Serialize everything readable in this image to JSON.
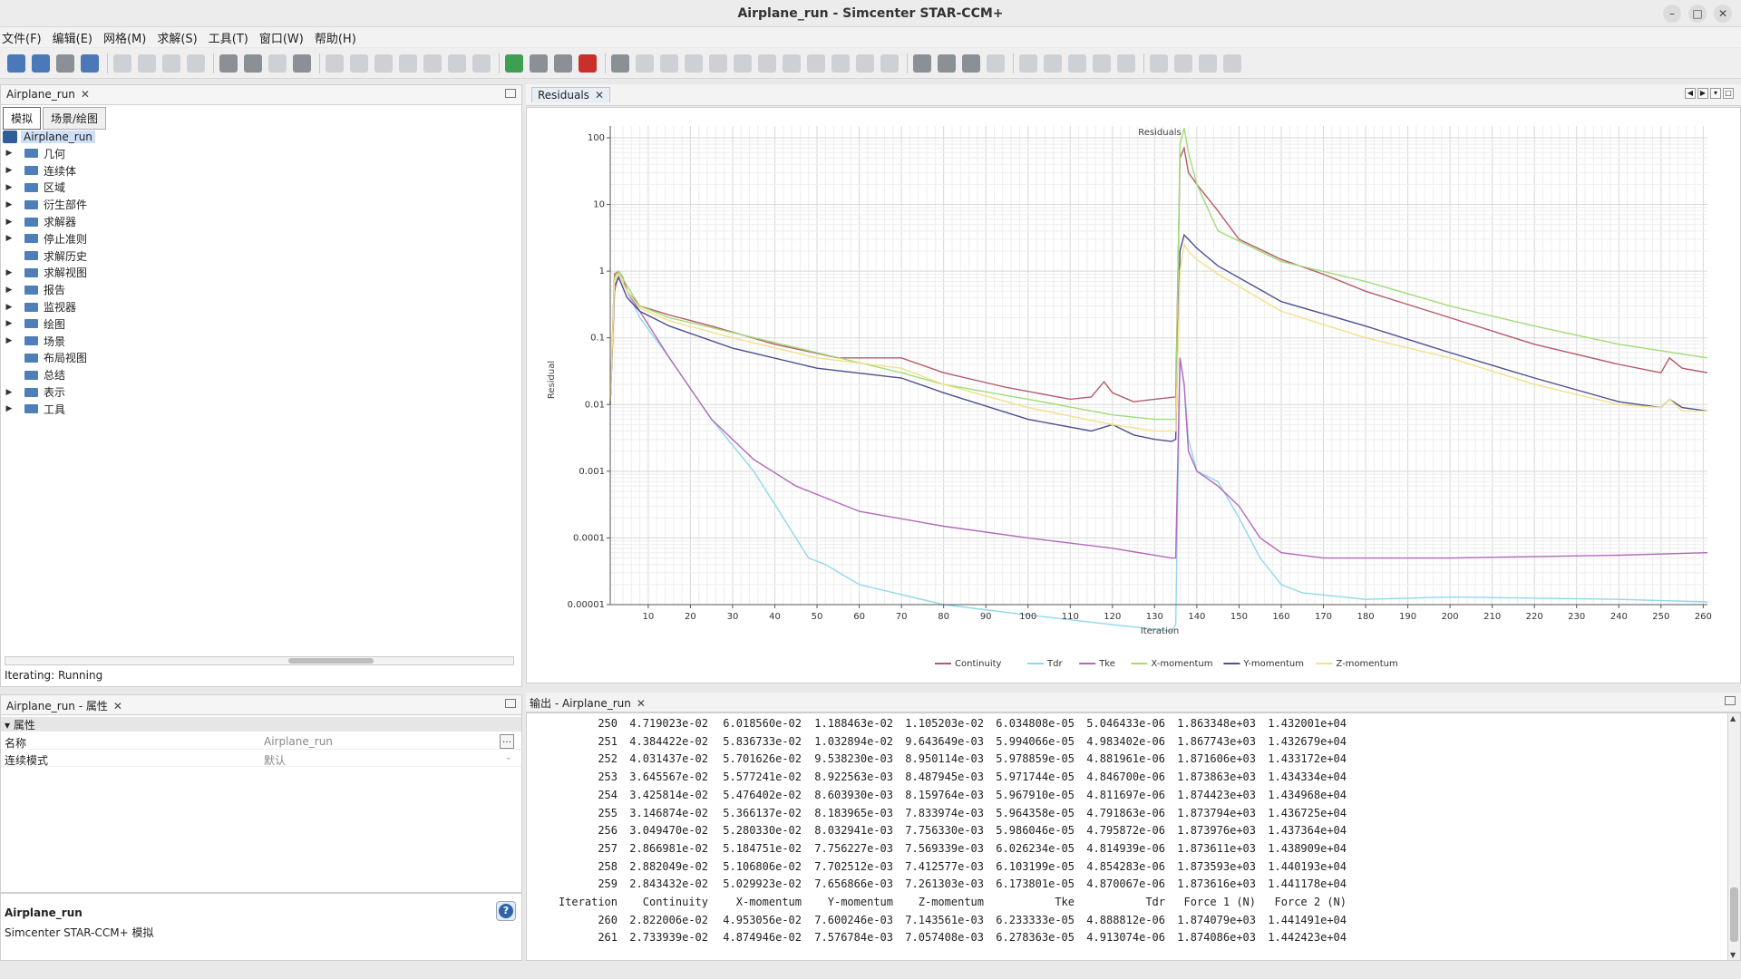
{
  "window": {
    "title": "Airplane_run - Simcenter STAR-CCM+"
  },
  "menu": [
    "文件(F)",
    "编辑(E)",
    "网格(M)",
    "求解(S)",
    "工具(T)",
    "窗口(W)",
    "帮助(H)"
  ],
  "tree_panel": {
    "tab_label": "Airplane_run",
    "subtabs": [
      "模拟",
      "场景/绘图"
    ],
    "root_label": "Airplane_run",
    "items": [
      {
        "label": "几何",
        "expandable": true
      },
      {
        "label": "连续体",
        "expandable": true
      },
      {
        "label": "区域",
        "expandable": true
      },
      {
        "label": "衍生部件",
        "expandable": true
      },
      {
        "label": "求解器",
        "expandable": true
      },
      {
        "label": "停止准则",
        "expandable": true
      },
      {
        "label": "求解历史",
        "expandable": false
      },
      {
        "label": "求解视图",
        "expandable": true
      },
      {
        "label": "报告",
        "expandable": true
      },
      {
        "label": "监视器",
        "expandable": true
      },
      {
        "label": "绘图",
        "expandable": true
      },
      {
        "label": "场景",
        "expandable": true
      },
      {
        "label": "布局视图",
        "expandable": false
      },
      {
        "label": "总结",
        "expandable": false
      },
      {
        "label": "表示",
        "expandable": true
      },
      {
        "label": "工具",
        "expandable": true
      }
    ],
    "status": "Iterating: Running"
  },
  "properties_panel": {
    "tab_label": "Airplane_run - 属性",
    "header": "属性",
    "rows": [
      {
        "key": "名称",
        "value": "Airplane_run",
        "has_button": true
      },
      {
        "key": "连续模式",
        "value": "默认",
        "has_button": false
      }
    ]
  },
  "description": {
    "name": "Airplane_run",
    "text": "Simcenter STAR-CCM+ 模拟"
  },
  "plot_tab": {
    "label": "Residuals"
  },
  "chart_data": {
    "type": "line",
    "title": "Residuals",
    "xlabel": "Iteration",
    "ylabel": "Residual",
    "yscale": "log",
    "xlim": [
      1,
      261
    ],
    "ylim": [
      1e-05,
      150
    ],
    "xticks": [
      10,
      20,
      30,
      40,
      50,
      60,
      70,
      80,
      90,
      100,
      110,
      120,
      130,
      140,
      150,
      160,
      170,
      180,
      190,
      200,
      210,
      220,
      230,
      240,
      250,
      260
    ],
    "yticks": [
      {
        "value": 100,
        "label": "100"
      },
      {
        "value": 10,
        "label": "10"
      },
      {
        "value": 1,
        "label": "1"
      },
      {
        "value": 0.1,
        "label": "0.1"
      },
      {
        "value": 0.01,
        "label": "0.01"
      },
      {
        "value": 0.001,
        "label": "0.001"
      },
      {
        "value": 0.0001,
        "label": "0.0001"
      },
      {
        "value": 1e-05,
        "label": "0.00001"
      }
    ],
    "grid": true,
    "legend_position": "bottom",
    "series": [
      {
        "name": "Continuity",
        "color": "#b65a6a",
        "x": [
          1,
          2,
          3,
          4,
          5,
          8,
          15,
          25,
          40,
          55,
          65,
          70,
          80,
          95,
          110,
          115,
          118,
          120,
          125,
          130,
          135,
          136,
          137,
          138,
          140,
          145,
          150,
          160,
          170,
          180,
          200,
          220,
          240,
          250,
          252,
          255,
          261
        ],
        "y": [
          0.01,
          0.9,
          1.0,
          0.8,
          0.5,
          0.3,
          0.22,
          0.15,
          0.08,
          0.05,
          0.05,
          0.05,
          0.03,
          0.018,
          0.012,
          0.013,
          0.022,
          0.015,
          0.011,
          0.012,
          0.013,
          50,
          70,
          30,
          20,
          8,
          3,
          1.5,
          0.9,
          0.5,
          0.2,
          0.08,
          0.04,
          0.03,
          0.05,
          0.035,
          0.03
        ]
      },
      {
        "name": "Tdr",
        "color": "#8fd8ea",
        "x": [
          1,
          2,
          3,
          5,
          8,
          15,
          25,
          35,
          42,
          48,
          52,
          60,
          80,
          100,
          120,
          134,
          135,
          136,
          137,
          138,
          140,
          145,
          150,
          155,
          160,
          165,
          180,
          200,
          240,
          261
        ],
        "y": [
          0.01,
          0.5,
          0.9,
          0.5,
          0.2,
          0.05,
          0.006,
          0.001,
          0.0002,
          5e-05,
          4e-05,
          2e-05,
          1e-05,
          7e-06,
          5e-06,
          4e-06,
          5e-06,
          0.05,
          0.02,
          0.003,
          0.001,
          0.0007,
          0.0002,
          5e-05,
          2e-05,
          1.5e-05,
          1.2e-05,
          1.3e-05,
          1.2e-05,
          1.1e-05
        ]
      },
      {
        "name": "Tke",
        "color": "#b368bc",
        "x": [
          1,
          2,
          3,
          5,
          8,
          15,
          25,
          35,
          45,
          60,
          80,
          100,
          120,
          134,
          135,
          136,
          137,
          138,
          140,
          145,
          150,
          155,
          160,
          170,
          200,
          240,
          261
        ],
        "y": [
          0.01,
          0.5,
          0.9,
          0.5,
          0.25,
          0.05,
          0.006,
          0.0015,
          0.0006,
          0.00025,
          0.00015,
          0.0001,
          7e-05,
          5e-05,
          5e-05,
          0.05,
          0.02,
          0.002,
          0.001,
          0.0006,
          0.0003,
          0.0001,
          6e-05,
          5e-05,
          5e-05,
          5.5e-05,
          6e-05
        ]
      },
      {
        "name": "X-momentum",
        "color": "#a0dc78",
        "x": [
          1,
          2,
          3,
          5,
          8,
          15,
          30,
          50,
          70,
          80,
          100,
          120,
          130,
          134,
          135,
          136,
          137,
          138,
          140,
          145,
          160,
          180,
          200,
          220,
          240,
          261
        ],
        "y": [
          0.01,
          0.8,
          1.0,
          0.6,
          0.3,
          0.2,
          0.12,
          0.06,
          0.03,
          0.02,
          0.012,
          0.007,
          0.006,
          0.006,
          0.006,
          80,
          140,
          60,
          20,
          4,
          1.4,
          0.7,
          0.3,
          0.15,
          0.08,
          0.05
        ]
      },
      {
        "name": "Y-momentum",
        "color": "#4e4f8e",
        "x": [
          1,
          2,
          3,
          5,
          8,
          15,
          30,
          50,
          70,
          80,
          100,
          115,
          120,
          125,
          130,
          134,
          135,
          136,
          137,
          138,
          140,
          145,
          160,
          180,
          200,
          220,
          240,
          250,
          252,
          255,
          261
        ],
        "y": [
          0.01,
          0.6,
          0.8,
          0.4,
          0.25,
          0.15,
          0.07,
          0.035,
          0.025,
          0.015,
          0.006,
          0.004,
          0.005,
          0.0035,
          0.003,
          0.0028,
          0.003,
          2,
          3.5,
          3,
          2.2,
          1.2,
          0.35,
          0.15,
          0.06,
          0.025,
          0.011,
          0.009,
          0.012,
          0.009,
          0.008
        ]
      },
      {
        "name": "Z-momentum",
        "color": "#f2e08a",
        "x": [
          1,
          2,
          3,
          5,
          8,
          15,
          30,
          50,
          70,
          80,
          100,
          120,
          130,
          134,
          135,
          136,
          137,
          138,
          140,
          145,
          160,
          180,
          200,
          220,
          240,
          250,
          252,
          255,
          261
        ],
        "y": [
          0.01,
          0.7,
          0.9,
          0.5,
          0.28,
          0.18,
          0.1,
          0.05,
          0.035,
          0.02,
          0.009,
          0.005,
          0.004,
          0.004,
          0.004,
          1,
          2.5,
          2,
          1.5,
          0.9,
          0.25,
          0.1,
          0.05,
          0.02,
          0.01,
          0.009,
          0.012,
          0.008,
          0.008
        ]
      }
    ]
  },
  "output_panel": {
    "tab_label": "输出 - Airplane_run",
    "header": [
      "Iteration",
      "Continuity",
      "X-momentum",
      "Y-momentum",
      "Z-momentum",
      "Tke",
      "Tdr",
      "Force 1 (N)",
      "Force 2 (N)"
    ],
    "rows_before_header": [
      [
        "250",
        "4.719023e-02",
        "6.018560e-02",
        "1.188463e-02",
        "1.105203e-02",
        "6.034808e-05",
        "5.046433e-06",
        "1.863348e+03",
        "1.432001e+04"
      ],
      [
        "251",
        "4.384422e-02",
        "5.836733e-02",
        "1.032894e-02",
        "9.643649e-03",
        "5.994066e-05",
        "4.983402e-06",
        "1.867743e+03",
        "1.432679e+04"
      ],
      [
        "252",
        "4.031437e-02",
        "5.701626e-02",
        "9.538230e-03",
        "8.950114e-03",
        "5.978859e-05",
        "4.881961e-06",
        "1.871606e+03",
        "1.433172e+04"
      ],
      [
        "253",
        "3.645567e-02",
        "5.577241e-02",
        "8.922563e-03",
        "8.487945e-03",
        "5.971744e-05",
        "4.846700e-06",
        "1.873863e+03",
        "1.434334e+04"
      ],
      [
        "254",
        "3.425814e-02",
        "5.476402e-02",
        "8.603930e-03",
        "8.159764e-03",
        "5.967910e-05",
        "4.811697e-06",
        "1.874423e+03",
        "1.434968e+04"
      ],
      [
        "255",
        "3.146874e-02",
        "5.366137e-02",
        "8.183965e-03",
        "7.833974e-03",
        "5.964358e-05",
        "4.791863e-06",
        "1.873794e+03",
        "1.436725e+04"
      ],
      [
        "256",
        "3.049470e-02",
        "5.280330e-02",
        "8.032941e-03",
        "7.756330e-03",
        "5.986046e-05",
        "4.795872e-06",
        "1.873976e+03",
        "1.437364e+04"
      ],
      [
        "257",
        "2.866981e-02",
        "5.184751e-02",
        "7.756227e-03",
        "7.569339e-03",
        "6.026234e-05",
        "4.814939e-06",
        "1.873611e+03",
        "1.438909e+04"
      ],
      [
        "258",
        "2.882049e-02",
        "5.106806e-02",
        "7.702512e-03",
        "7.412577e-03",
        "6.103199e-05",
        "4.854283e-06",
        "1.873593e+03",
        "1.440193e+04"
      ],
      [
        "259",
        "2.843432e-02",
        "5.029923e-02",
        "7.656866e-03",
        "7.261303e-03",
        "6.173801e-05",
        "4.870067e-06",
        "1.873616e+03",
        "1.441178e+04"
      ]
    ],
    "rows_after_header": [
      [
        "260",
        "2.822006e-02",
        "4.953056e-02",
        "7.600246e-03",
        "7.143561e-03",
        "6.233333e-05",
        "4.888812e-06",
        "1.874079e+03",
        "1.441491e+04"
      ],
      [
        "261",
        "2.733939e-02",
        "4.874946e-02",
        "7.576784e-03",
        "7.057408e-03",
        "6.278363e-05",
        "4.913074e-06",
        "1.874086e+03",
        "1.442423e+04"
      ]
    ]
  }
}
